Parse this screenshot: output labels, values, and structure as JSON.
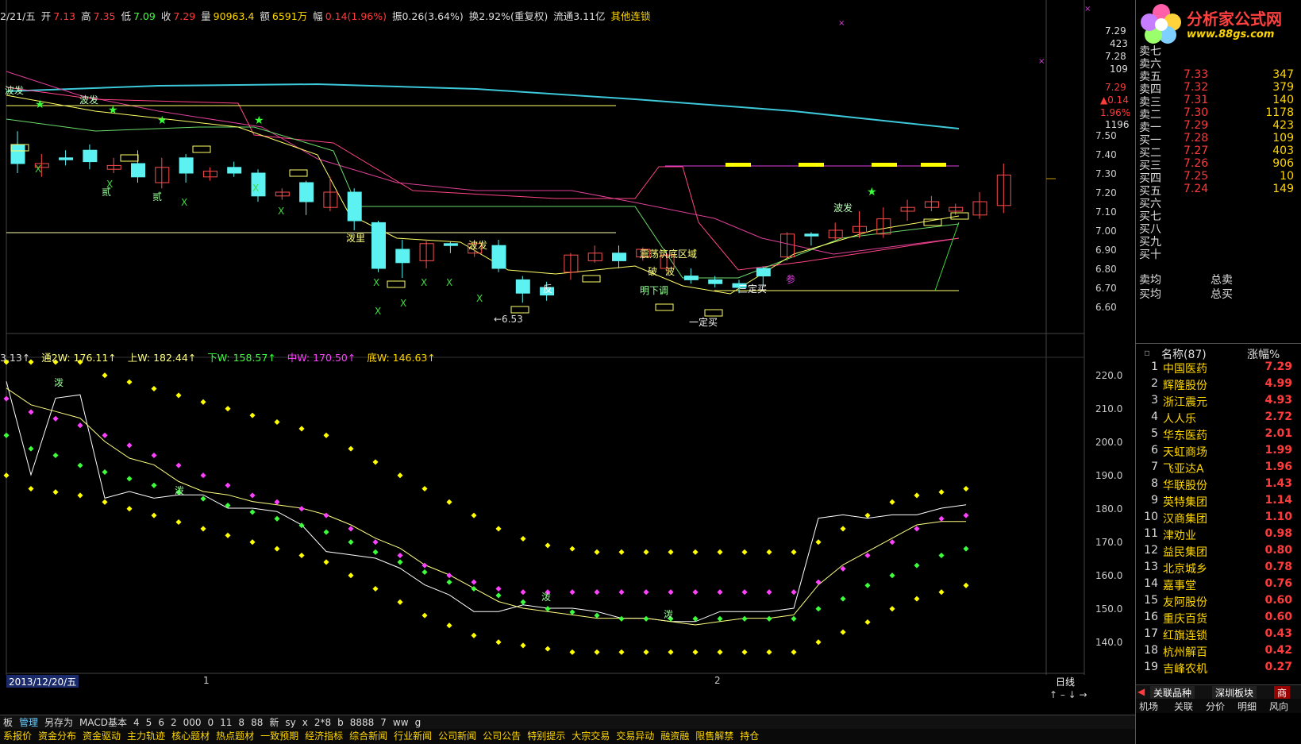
{
  "header": {
    "date": "2/21/五",
    "open_label": "开",
    "open": "7.13",
    "high_label": "高",
    "high": "7.35",
    "low_label": "低",
    "low": "7.09",
    "close_label": "收",
    "close": "7.29",
    "vol_label": "量",
    "vol": "90963.4",
    "amt_label": "额",
    "amt": "6591万",
    "chg_label": "幅",
    "chg": "0.14(1.96%)",
    "amp": "振0.26(3.64%)",
    "turnover": "换2.92%(重复权)",
    "float_cap": "流通3.11亿",
    "other": "其他连锁"
  },
  "indicator": {
    "v0": "3.13↑",
    "v1": "通2W: 176.11↑",
    "v2": "上W: 182.44↑",
    "v3": "下W: 158.57↑",
    "v4": "中W: 170.50↑",
    "v5": "底W: 146.63↑"
  },
  "price_axis": [
    "7.50",
    "7.40",
    "7.30",
    "7.20",
    "7.10",
    "7.00",
    "6.90",
    "6.80",
    "6.70",
    "6.60"
  ],
  "ind_axis": [
    "220.0",
    "210.0",
    "200.0",
    "190.0",
    "180.0",
    "170.0",
    "160.0",
    "150.0",
    "140.0"
  ],
  "quote_box": [
    "7.29",
    "423",
    "7.28",
    "109",
    "7.29",
    "▲0.14",
    "1.96%",
    "1196"
  ],
  "logo": {
    "title": "分析家公式网",
    "url": "www.88gs.com"
  },
  "orders": [
    {
      "label": "卖七",
      "price": "",
      "vol": ""
    },
    {
      "label": "卖六",
      "price": "",
      "vol": ""
    },
    {
      "label": "卖五",
      "price": "7.33",
      "vol": "347"
    },
    {
      "label": "卖四",
      "price": "7.32",
      "vol": "379"
    },
    {
      "label": "卖三",
      "price": "7.31",
      "vol": "140"
    },
    {
      "label": "卖二",
      "price": "7.30",
      "vol": "1178"
    },
    {
      "label": "卖一",
      "price": "7.29",
      "vol": "423"
    },
    {
      "label": "买一",
      "price": "7.28",
      "vol": "109"
    },
    {
      "label": "买二",
      "price": "7.27",
      "vol": "403"
    },
    {
      "label": "买三",
      "price": "7.26",
      "vol": "906"
    },
    {
      "label": "买四",
      "price": "7.25",
      "vol": "10"
    },
    {
      "label": "买五",
      "price": "7.24",
      "vol": "149"
    },
    {
      "label": "买六",
      "price": "",
      "vol": ""
    },
    {
      "label": "买七",
      "price": "",
      "vol": ""
    },
    {
      "label": "买八",
      "price": "",
      "vol": ""
    },
    {
      "label": "买九",
      "price": "",
      "vol": ""
    },
    {
      "label": "买十",
      "price": "",
      "vol": ""
    }
  ],
  "avg": {
    "sell_avg": "卖均",
    "buy_avg": "买均",
    "total_sell": "总卖",
    "total_buy": "总买"
  },
  "list_header": {
    "name": "名称(87)",
    "chg": "涨幅%"
  },
  "stocks": [
    {
      "idx": "1",
      "name": "中国医药",
      "pct": "7.29"
    },
    {
      "idx": "2",
      "name": "辉隆股份",
      "pct": "4.99"
    },
    {
      "idx": "3",
      "name": "浙江震元",
      "pct": "4.93"
    },
    {
      "idx": "4",
      "name": "人人乐",
      "pct": "2.72"
    },
    {
      "idx": "5",
      "name": "华东医药",
      "pct": "2.01"
    },
    {
      "idx": "6",
      "name": "天虹商场",
      "pct": "1.99"
    },
    {
      "idx": "7",
      "name": "飞亚达A",
      "pct": "1.96"
    },
    {
      "idx": "8",
      "name": "华联股份",
      "pct": "1.43"
    },
    {
      "idx": "9",
      "name": "英特集团",
      "pct": "1.14"
    },
    {
      "idx": "10",
      "name": "汉商集团",
      "pct": "1.10"
    },
    {
      "idx": "11",
      "name": "津劝业",
      "pct": "0.98"
    },
    {
      "idx": "12",
      "name": "益民集团",
      "pct": "0.80"
    },
    {
      "idx": "13",
      "name": "北京城乡",
      "pct": "0.78"
    },
    {
      "idx": "14",
      "name": "嘉事堂",
      "pct": "0.76"
    },
    {
      "idx": "15",
      "name": "友阿股份",
      "pct": "0.60"
    },
    {
      "idx": "16",
      "name": "重庆百货",
      "pct": "0.60"
    },
    {
      "idx": "17",
      "name": "红旗连锁",
      "pct": "0.43"
    },
    {
      "idx": "18",
      "name": "杭州解百",
      "pct": "0.42"
    },
    {
      "idx": "19",
      "name": "吉峰农机",
      "pct": "0.27"
    }
  ],
  "bottom_tabs": {
    "related": "关联品种",
    "shenzhen": "深圳板块",
    "shang": "商"
  },
  "bottom_tabs2": [
    "机场",
    "关联",
    "分价",
    "明细",
    "风向"
  ],
  "time_axis": {
    "date_label": "2013/12/20/五",
    "m1": "1",
    "m2": "2",
    "period": "日线"
  },
  "toolbar": [
    "板",
    "管理",
    "另存为",
    "MACD基本",
    "4",
    "5",
    "6",
    "2",
    "000",
    "0",
    "11",
    "8",
    "88",
    "新",
    "sy",
    "x",
    "2*8",
    "b",
    "8888",
    "7",
    "ww",
    "g"
  ],
  "funcbar": [
    "系报价",
    "资金分布",
    "资金驱动",
    "主力轨迹",
    "核心题材",
    "热点题材",
    "一致预期",
    "经济指标",
    "综合新闻",
    "行业新闻",
    "公司新闻",
    "公司公告",
    "特别提示",
    "大宗交易",
    "交易异动",
    "融资融",
    "限售解禁",
    "持仓"
  ],
  "annotations": [
    "波发",
    "波发",
    "贰",
    "贰",
    "泼里",
    "波发",
    "震荡筑底区域",
    "破",
    "波",
    "明下调",
    "反",
    "←6.53",
    "一定买",
    "三定买",
    "参",
    "波发",
    "泼",
    "泼",
    "泼",
    "泼"
  ]
}
